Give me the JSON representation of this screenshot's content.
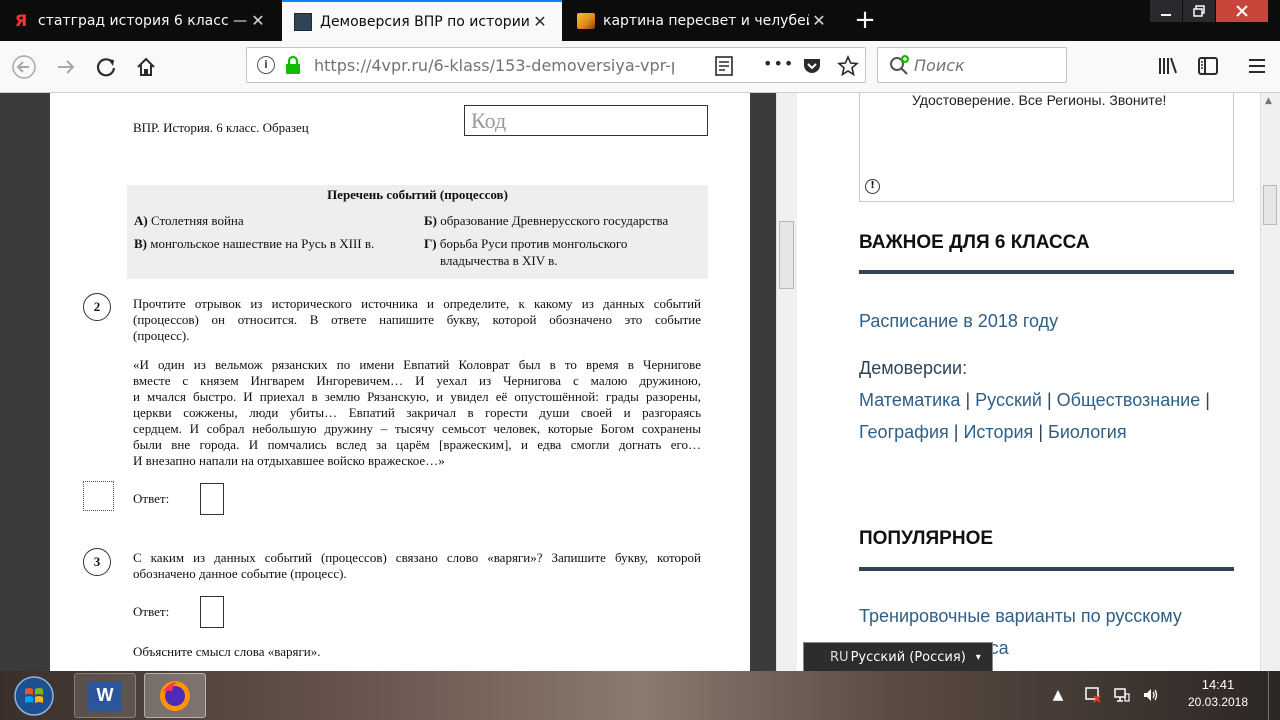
{
  "browser": {
    "tabs": [
      {
        "label": "статград история 6 класс — Я",
        "icon": "yandex-icon",
        "active": false
      },
      {
        "label": "Демоверсия ВПР по истории",
        "icon": "page-icon",
        "active": true
      },
      {
        "label": "картина пересвет и челубей:",
        "icon": "image-icon",
        "active": false
      }
    ],
    "new_tab": "+",
    "url": "https://4vpr.ru/6-klass/153-demoversiya-vpr-p",
    "search_placeholder": "Поиск",
    "menu_dots": "•••"
  },
  "pdf": {
    "header_left": "ВПР. История. 6 класс. Образец",
    "code_label": "Код",
    "events_title": "Перечень событий (процессов)",
    "events": [
      {
        "letter": "А)",
        "text": "Столетняя война"
      },
      {
        "letter": "Б)",
        "text": "образование Древнерусского государства"
      },
      {
        "letter": "В)",
        "text": "монгольское нашествие на Русь в XIII в."
      },
      {
        "letter": "Г)",
        "text": "борьба Руси против монгольского"
      },
      {
        "letter": "",
        "text": "владычества в XIV в."
      }
    ],
    "q2": {
      "num": "2",
      "lines": [
        "Прочтите отрывок из исторического источника и определите, к какому из данных событий",
        "(процессов) он относится. В ответе напишите букву, которой обозначено это событие",
        "(процесс)."
      ],
      "quote_lines": [
        "«И один из вельмож рязанских по имени Евпатий Коловрат был в то время в Чернигове",
        "вместе с князем Ингварем Ингоревичем… И уехал из Чернигова с малою дружиною,",
        "и мчался быстро. И приехал в землю Рязанскую, и увидел её опустошённой: грады разорены,",
        "церкви сожжены, люди убиты… Евпатий закричал в горести души своей и разгораясь",
        "сердцем. И собрал небольшую дружину – тысячу семьсот человек, которые Богом сохранены",
        "были вне города. И помчались вслед за царём [вражеским], и едва смогли догнать его…",
        "И внезапно напали на отдыхавшее войско вражеское…»"
      ],
      "answer_label": "Ответ:"
    },
    "q3": {
      "num": "3",
      "lines": [
        "С каким из данных событий (процессов) связано слово «варяги»? Запишите букву, которой",
        "обозначено данное событие (процесс)."
      ],
      "answer_label": "Ответ:",
      "explain": "Объясните смысл слова «варяги»."
    }
  },
  "sidebar": {
    "ad_text": "Удостоверение. Все Регионы. Звоните!",
    "ad_info": "!",
    "section1_title": "ВАЖНОЕ ДЛЯ 6 КЛАССА",
    "schedule_link": "Расписание в 2018 году",
    "demo_label": "Демоверсии:",
    "demo_links": [
      "Математика",
      "Русский",
      "Обществознание",
      "География",
      "История",
      "Биология"
    ],
    "separator": "|",
    "section2_title": "ПОПУЛЯРНОЕ",
    "popular_line1": "Тренировочные варианты по русскому",
    "popular_line2_tail": "класса"
  },
  "language_bar": {
    "code": "RU",
    "name": "Русский (Россия)"
  },
  "taskbar": {
    "time": "14:41",
    "date": "20.03.2018",
    "apps": [
      "start-orb",
      "word-app",
      "firefox-app"
    ]
  }
}
